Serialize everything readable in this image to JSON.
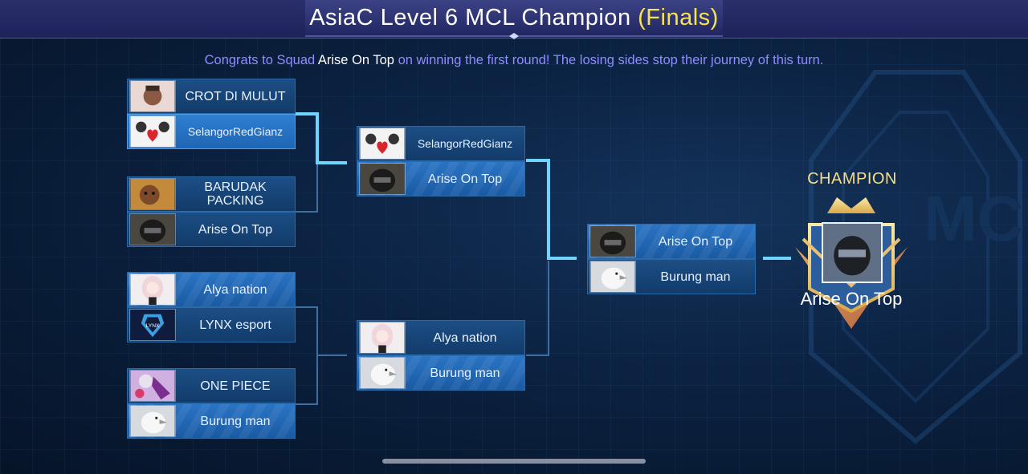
{
  "header": {
    "title_main": "AsiaC Level 6 MCL Champion",
    "title_highlight": "(Finals)"
  },
  "message": {
    "prefix": "Congrats to Squad",
    "team": "Arise On Top",
    "suffix": "on winning the first round! The losing sides stop their journey of this turn."
  },
  "round1": [
    {
      "top": "CROT DI MULUT",
      "bottom": "SelangorRedGianz"
    },
    {
      "top": "BARUDAK PACKING",
      "bottom": "Arise On Top"
    },
    {
      "top": "Alya nation",
      "bottom": "LYNX  esport"
    },
    {
      "top": "ONE PIECE",
      "bottom": "Burung man"
    }
  ],
  "round2": [
    {
      "top": "SelangorRedGianz",
      "bottom": "Arise On Top"
    },
    {
      "top": "Alya nation",
      "bottom": "Burung man"
    }
  ],
  "final": {
    "top": "Arise On Top",
    "bottom": "Burung man"
  },
  "champion": {
    "label": "CHAMPION",
    "name": "Arise On Top"
  },
  "colors": {
    "highlight": "#f8e44a",
    "message": "#8f8dff",
    "connector_active": "#6fd4ff",
    "champion_gold": "#f6df8a"
  },
  "icons": {
    "avatar_crot": "person-photo-avatar",
    "avatar_selangor": "cartoon-heart-avatar",
    "avatar_barudak": "person-photo-avatar",
    "avatar_arise": "helmet-photo-avatar",
    "avatar_alya": "anime-girl-avatar",
    "avatar_lynx": "lynx-logo-avatar",
    "avatar_onepiece": "anime-art-avatar",
    "avatar_burung": "white-bird-avatar",
    "champion_badge": "crown-badge-icon"
  }
}
